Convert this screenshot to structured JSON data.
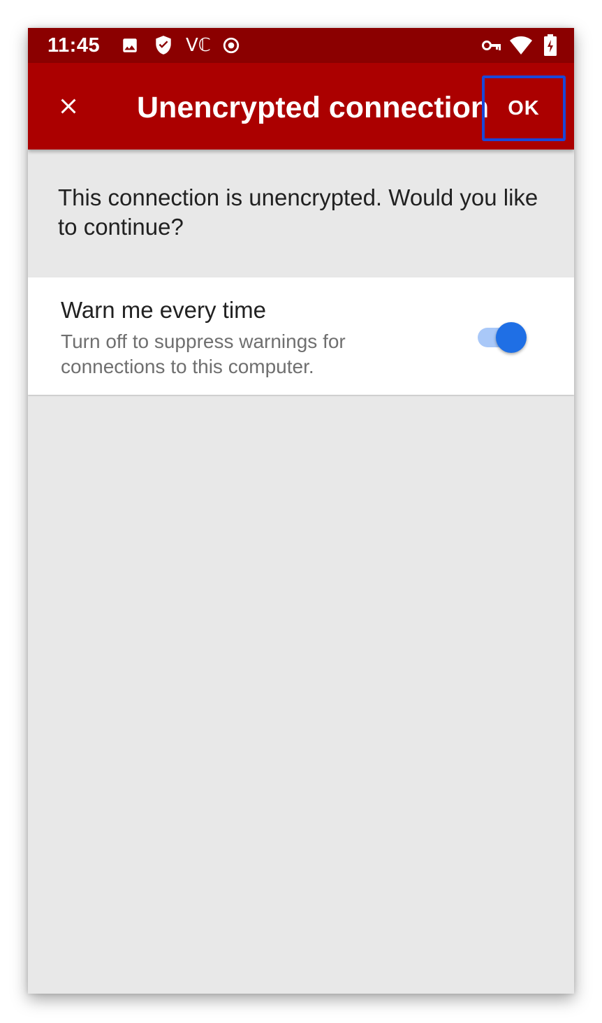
{
  "status_bar": {
    "time": "11:45",
    "vpn_text": "Vℂ",
    "icons": [
      "image-icon",
      "shield-check-icon",
      "volte-icon",
      "record-icon",
      "vpn-key-icon",
      "wifi-icon",
      "battery-charging-icon"
    ]
  },
  "app_bar": {
    "close_icon": "close-icon",
    "title": "Unencrypted connection",
    "ok_label": "OK"
  },
  "message": "This connection is unencrypted. Would you like to continue?",
  "setting": {
    "title": "Warn me every time",
    "summary": "Turn off to suppress warnings for connections to this computer.",
    "enabled": true
  },
  "colors": {
    "status_bar": "#8b0000",
    "app_bar": "#ab0000",
    "background": "#e8e8e8",
    "switch_thumb": "#1f6fe5",
    "switch_track": "#a9c8f8",
    "highlight_box": "#1a47d8"
  }
}
